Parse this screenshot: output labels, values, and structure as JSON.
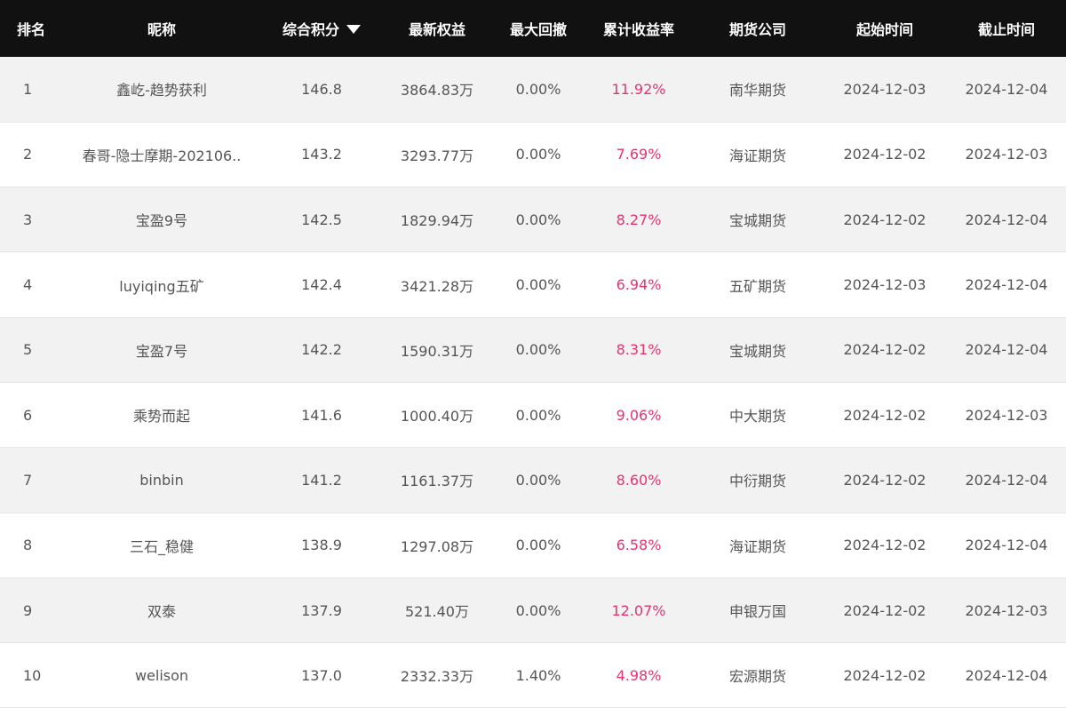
{
  "colors": {
    "header_bg": "#111111",
    "header_text": "#ffffff",
    "row_alt_bg": "#f2f2f2",
    "cell_text": "#555555",
    "yield_text": "#e8336d"
  },
  "table": {
    "headers": {
      "rank": "排名",
      "nickname": "昵称",
      "score": "综合积分",
      "equity": "最新权益",
      "drawdown": "最大回撤",
      "yield": "累计收益率",
      "company": "期货公司",
      "start": "起始时间",
      "end": "截止时间"
    },
    "sort_icon": "caret-down-icon",
    "rows": [
      {
        "rank": "1",
        "nickname": "鑫屹-趋势获利",
        "score": "146.8",
        "equity": "3864.83万",
        "drawdown": "0.00%",
        "yield": "11.92%",
        "company": "南华期货",
        "start": "2024-12-03",
        "end": "2024-12-04"
      },
      {
        "rank": "2",
        "nickname": "春哥-隐士摩期-202106..",
        "score": "143.2",
        "equity": "3293.77万",
        "drawdown": "0.00%",
        "yield": "7.69%",
        "company": "海证期货",
        "start": "2024-12-02",
        "end": "2024-12-03"
      },
      {
        "rank": "3",
        "nickname": "宝盈9号",
        "score": "142.5",
        "equity": "1829.94万",
        "drawdown": "0.00%",
        "yield": "8.27%",
        "company": "宝城期货",
        "start": "2024-12-02",
        "end": "2024-12-04"
      },
      {
        "rank": "4",
        "nickname": "luyiqing五矿",
        "score": "142.4",
        "equity": "3421.28万",
        "drawdown": "0.00%",
        "yield": "6.94%",
        "company": "五矿期货",
        "start": "2024-12-03",
        "end": "2024-12-04"
      },
      {
        "rank": "5",
        "nickname": "宝盈7号",
        "score": "142.2",
        "equity": "1590.31万",
        "drawdown": "0.00%",
        "yield": "8.31%",
        "company": "宝城期货",
        "start": "2024-12-02",
        "end": "2024-12-04"
      },
      {
        "rank": "6",
        "nickname": "乘势而起",
        "score": "141.6",
        "equity": "1000.40万",
        "drawdown": "0.00%",
        "yield": "9.06%",
        "company": "中大期货",
        "start": "2024-12-02",
        "end": "2024-12-03"
      },
      {
        "rank": "7",
        "nickname": "binbin",
        "score": "141.2",
        "equity": "1161.37万",
        "drawdown": "0.00%",
        "yield": "8.60%",
        "company": "中衍期货",
        "start": "2024-12-02",
        "end": "2024-12-04"
      },
      {
        "rank": "8",
        "nickname": "三石_稳健",
        "score": "138.9",
        "equity": "1297.08万",
        "drawdown": "0.00%",
        "yield": "6.58%",
        "company": "海证期货",
        "start": "2024-12-02",
        "end": "2024-12-04"
      },
      {
        "rank": "9",
        "nickname": "双泰",
        "score": "137.9",
        "equity": "521.40万",
        "drawdown": "0.00%",
        "yield": "12.07%",
        "company": "申银万国",
        "start": "2024-12-02",
        "end": "2024-12-03"
      },
      {
        "rank": "10",
        "nickname": "welison",
        "score": "137.0",
        "equity": "2332.33万",
        "drawdown": "1.40%",
        "yield": "4.98%",
        "company": "宏源期货",
        "start": "2024-12-02",
        "end": "2024-12-04"
      }
    ]
  }
}
